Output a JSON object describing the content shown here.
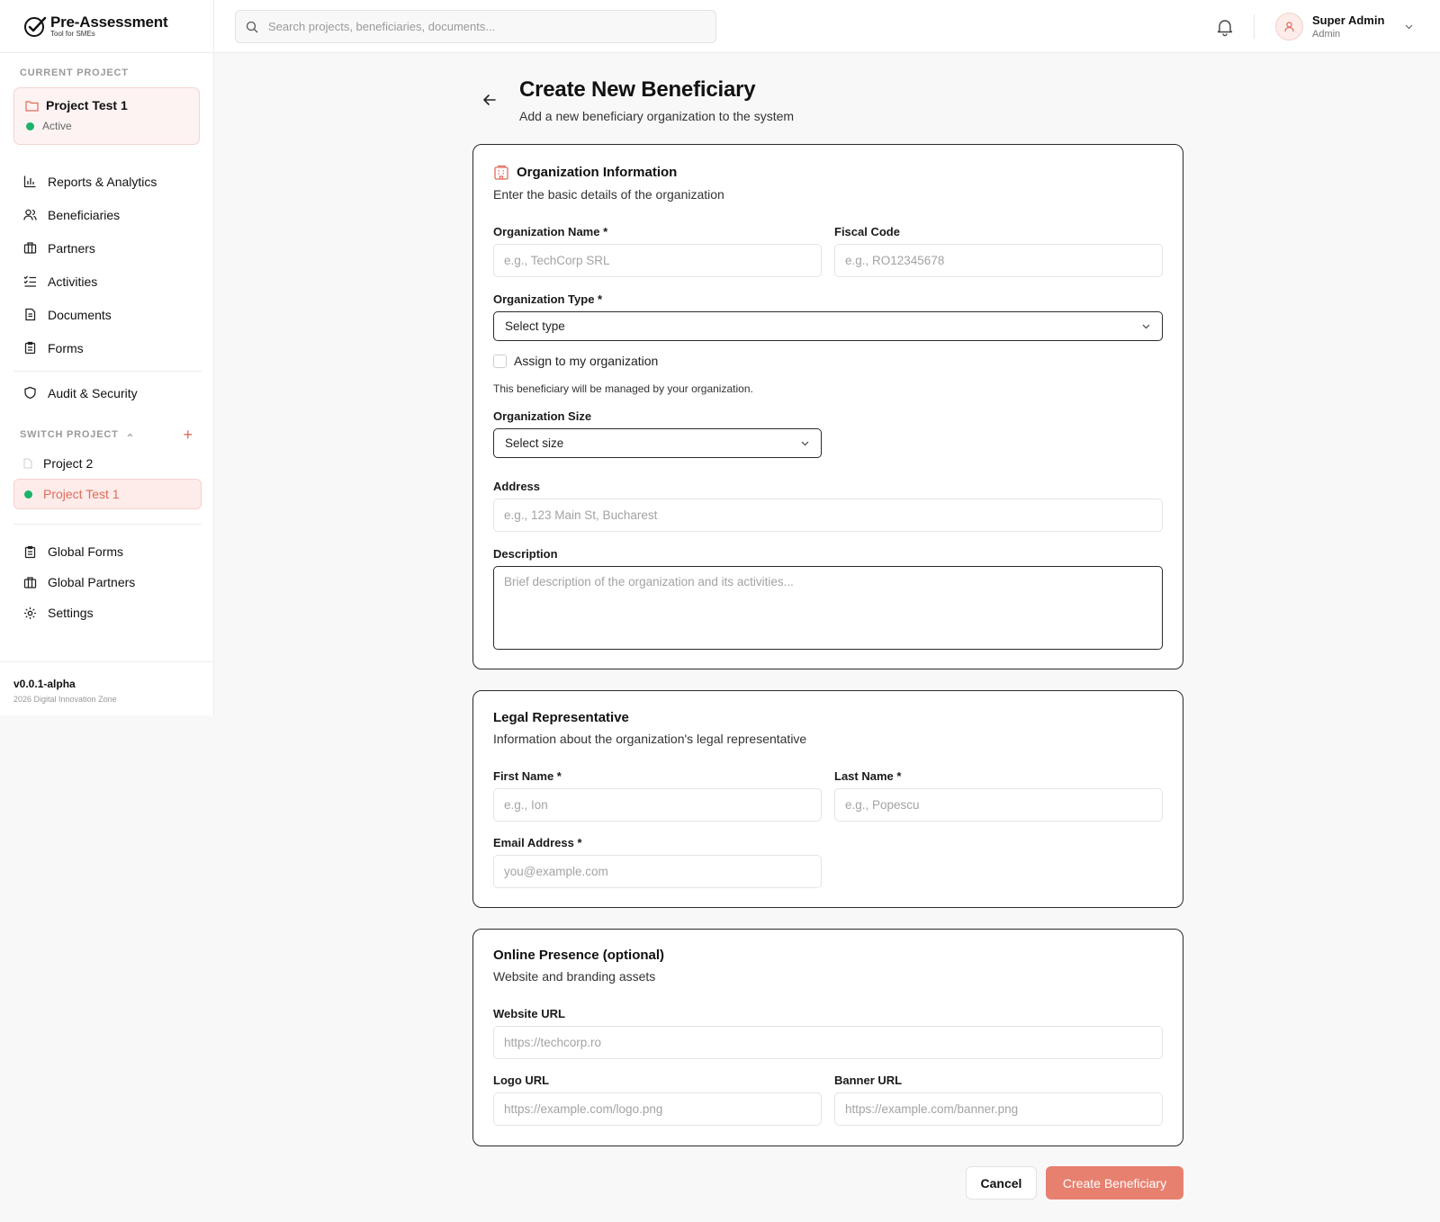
{
  "app": {
    "title": "Pre-Assessment",
    "subtitle": "Tool for SMEs"
  },
  "sidebar": {
    "current_project_label": "CURRENT PROJECT",
    "current_project": {
      "name": "Project Test 1",
      "status": "Active"
    },
    "nav": [
      {
        "label": "Reports & Analytics",
        "icon": "bar-chart-icon"
      },
      {
        "label": "Beneficiaries",
        "icon": "users-icon"
      },
      {
        "label": "Partners",
        "icon": "briefcase-icon"
      },
      {
        "label": "Activities",
        "icon": "list-checks-icon"
      },
      {
        "label": "Documents",
        "icon": "file-text-icon"
      },
      {
        "label": "Forms",
        "icon": "clipboard-icon"
      }
    ],
    "audit": {
      "label": "Audit & Security",
      "icon": "shield-icon"
    },
    "switch_project_label": "SWITCH PROJECT",
    "projects": [
      {
        "name": "Project 2",
        "active": false
      },
      {
        "name": "Project Test 1",
        "active": true
      }
    ],
    "global_nav": [
      {
        "label": "Global Forms",
        "icon": "clipboard-icon"
      },
      {
        "label": "Global Partners",
        "icon": "briefcase-icon"
      },
      {
        "label": "Settings",
        "icon": "gear-icon"
      }
    ],
    "version": "v0.0.1-alpha",
    "copyright": "2026 Digital Innovation Zone"
  },
  "header": {
    "search_placeholder": "Search projects, beneficiaries, documents...",
    "user_name": "Super Admin",
    "user_role": "Admin"
  },
  "page": {
    "title": "Create New Beneficiary",
    "subtitle": "Add a new beneficiary organization to the system"
  },
  "org": {
    "title": "Organization Information",
    "subtitle": "Enter the basic details of the organization",
    "name_label": "Organization Name *",
    "name_placeholder": "e.g., TechCorp SRL",
    "fiscal_label": "Fiscal Code",
    "fiscal_placeholder": "e.g., RO12345678",
    "type_label": "Organization Type *",
    "type_value": "Select type",
    "assign_label": "Assign to my organization",
    "assign_hint": "This beneficiary will be managed by your organization.",
    "size_label": "Organization Size",
    "size_value": "Select size",
    "address_label": "Address",
    "address_placeholder": "e.g., 123 Main St, Bucharest",
    "description_label": "Description",
    "description_placeholder": "Brief description of the organization and its activities..."
  },
  "legal": {
    "title": "Legal Representative",
    "subtitle": "Information about the organization's legal representative",
    "first_label": "First Name *",
    "first_placeholder": "e.g., Ion",
    "last_label": "Last Name *",
    "last_placeholder": "e.g., Popescu",
    "email_label": "Email Address *",
    "email_placeholder": "you@example.com"
  },
  "online": {
    "title": "Online Presence (optional)",
    "subtitle": "Website and branding assets",
    "website_label": "Website URL",
    "website_placeholder": "https://techcorp.ro",
    "logo_label": "Logo URL",
    "logo_placeholder": "https://example.com/logo.png",
    "banner_label": "Banner URL",
    "banner_placeholder": "https://example.com/banner.png"
  },
  "actions": {
    "cancel": "Cancel",
    "create": "Create Beneficiary"
  },
  "colors": {
    "accent": "#e7806f",
    "active_dot": "#1cb36a",
    "accent_text": "#e06b5b"
  }
}
